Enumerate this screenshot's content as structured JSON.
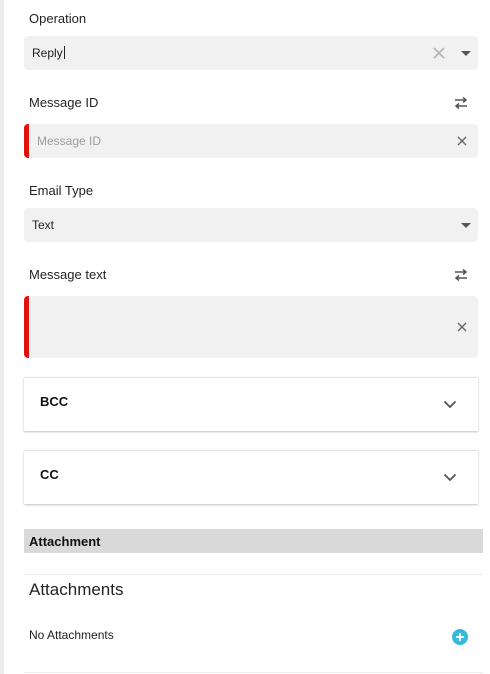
{
  "operation": {
    "label": "Operation",
    "value": "Reply"
  },
  "message_id": {
    "label": "Message ID",
    "placeholder": "Message ID"
  },
  "email_type": {
    "label": "Email Type",
    "value": "Text"
  },
  "message_text": {
    "label": "Message text",
    "value": ""
  },
  "bcc": {
    "title": "BCC"
  },
  "cc": {
    "title": "CC"
  },
  "attachment_section": {
    "title": "Attachment"
  },
  "attachments": {
    "title": "Attachments",
    "empty_text": "No Attachments"
  },
  "colors": {
    "error": "#e0140c",
    "accent": "#35b9dc",
    "field_bg": "#f1f1f1"
  },
  "icons": [
    "clear-icon",
    "dropdown-arrow-icon",
    "swap-icon",
    "chevron-down-icon",
    "add-circle-icon"
  ]
}
